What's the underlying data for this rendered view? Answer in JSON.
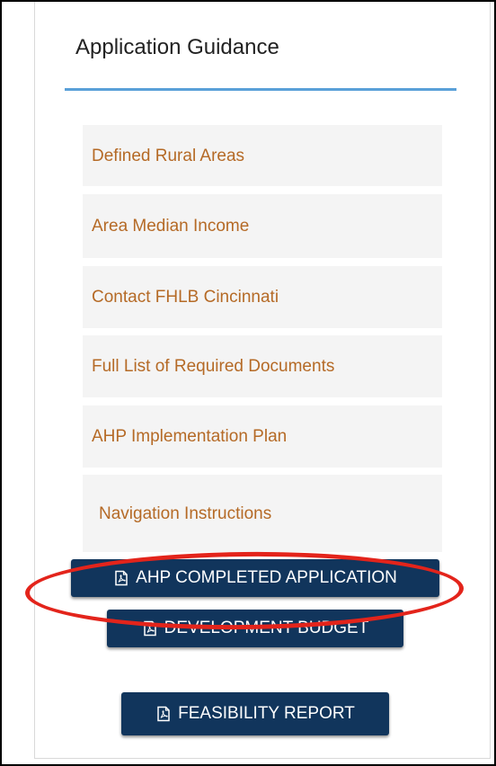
{
  "sidebar": {
    "title": "Application Guidance",
    "links": [
      {
        "label": "Defined Rural Areas"
      },
      {
        "label": "Area Median Income"
      },
      {
        "label": "Contact FHLB Cincinnati"
      },
      {
        "label": "Full List of Required Documents"
      },
      {
        "label": "AHP Implementation Plan"
      },
      {
        "label": "Navigation Instructions"
      }
    ],
    "buttons": [
      {
        "label": "AHP COMPLETED APPLICATION",
        "icon": "pdf-icon"
      },
      {
        "label": "DEVELOPMENT BUDGET",
        "icon": "pdf-icon"
      },
      {
        "label": "FEASIBILITY REPORT",
        "icon": "pdf-icon"
      }
    ]
  },
  "colors": {
    "link_text": "#b56a26",
    "link_bg": "#f4f4f4",
    "button_bg": "#11355c",
    "title_rule": "#5aa0d8",
    "annotation": "#e3241b"
  },
  "annotation": {
    "shape": "ellipse",
    "target": "AHP COMPLETED APPLICATION"
  }
}
